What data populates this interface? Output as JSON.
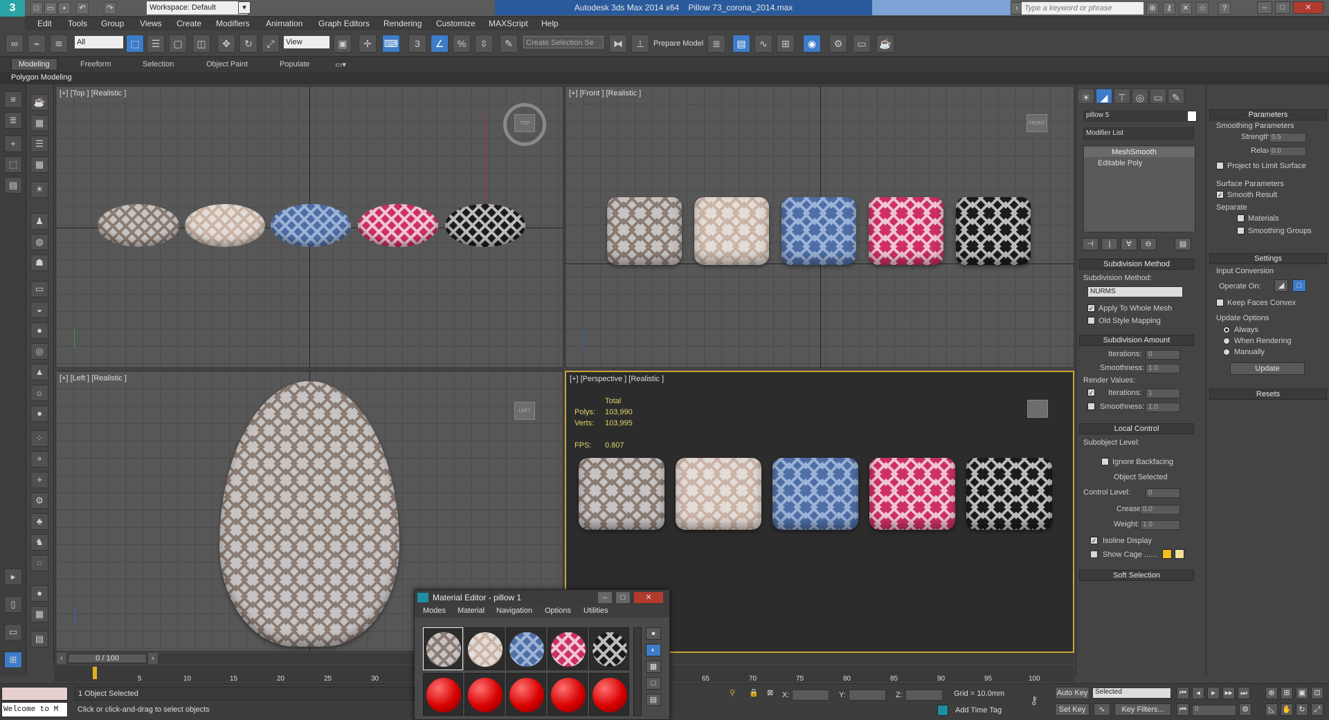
{
  "titlebar": {
    "workspace": "Workspace: Default",
    "app_title": "Autodesk 3ds Max  2014 x64",
    "file_title": "Pillow 73_corona_2014.max",
    "search_placeholder": "Type a keyword or phrase"
  },
  "menu": [
    "Edit",
    "Tools",
    "Group",
    "Views",
    "Create",
    "Modifiers",
    "Animation",
    "Graph Editors",
    "Rendering",
    "Customize",
    "MAXScript",
    "Help"
  ],
  "toolbar": {
    "selection_filter": "All",
    "ref_coord": "View",
    "selection_set": "Create Selection Se",
    "prepare_model": "Prepare Model"
  },
  "ribbon": {
    "tabs": [
      "Modeling",
      "Freeform",
      "Selection",
      "Object Paint",
      "Populate"
    ],
    "active_tab": "Modeling",
    "subpanel": "Polygon Modeling"
  },
  "viewports": {
    "top": "[+] [Top ] [Realistic ]",
    "front": "[+] [Front ] [Realistic ]",
    "left": "[+] [Left ] [Realistic ]",
    "perspective": "[+] [Perspective ] [Realistic ]",
    "stats": {
      "total_label": "Total",
      "polys_label": "Polys:",
      "polys": "103,990",
      "verts_label": "Verts:",
      "verts": "103,995",
      "fps_label": "FPS:",
      "fps": "0.807"
    },
    "viewcube": {
      "top": "TOP",
      "front": "FRONT",
      "left": "LEFT"
    }
  },
  "command_panel": {
    "object_name": "pillow 5",
    "modifier_list": "Modifier List",
    "stack": [
      "MeshSmooth",
      "Editable Poly"
    ],
    "subdivision_method": {
      "header": "Subdivision Method",
      "label": "Subdivision Method:",
      "value": "NURMS",
      "apply_whole_mesh": "Apply To Whole Mesh",
      "old_style_mapping": "Old Style Mapping"
    },
    "subdivision_amount": {
      "header": "Subdivision Amount",
      "iterations_label": "Iterations:",
      "iterations": "0",
      "smoothness_label": "Smoothness:",
      "smoothness": "1.0",
      "render_values": "Render Values:",
      "render_iterations_label": "Iterations:",
      "render_iterations": "1",
      "render_smoothness_label": "Smoothness:",
      "render_smoothness": "1.0"
    },
    "local_control": {
      "header": "Local Control",
      "subobject_level": "Subobject Level:",
      "ignore_backfacing": "Ignore Backfacing",
      "object_selected": "Object Selected",
      "control_level_label": "Control Level:",
      "control_level": "0",
      "crease_label": "Crease:",
      "crease": "0.0",
      "weight_label": "Weight:",
      "weight": "1.0",
      "isoline_display": "Isoline Display",
      "show_cage": "Show Cage ......"
    },
    "soft_selection": "Soft Selection"
  },
  "parameters_panel": {
    "header": "Parameters",
    "smoothing_params": "Smoothing Parameters",
    "strength_label": "Strength:",
    "strength": "0.5",
    "relax_label": "Relax:",
    "relax": "0.0",
    "project_limit": "Project to Limit Surface",
    "surface_params": "Surface Parameters",
    "smooth_result": "Smooth Result",
    "separate": "Separate",
    "materials": "Materials",
    "smoothing_groups": "Smoothing Groups",
    "settings_header": "Settings",
    "input_conversion": "Input Conversion",
    "operate_on": "Operate On:",
    "keep_faces_convex": "Keep Faces Convex",
    "update_options": "Update Options",
    "always": "Always",
    "when_rendering": "When Rendering",
    "manually": "Manually",
    "update_button": "Update",
    "resets": "Resets"
  },
  "timeline": {
    "frame": "0 / 100",
    "ticks": [
      "5",
      "10",
      "15",
      "20",
      "25",
      "30",
      "65",
      "70",
      "75",
      "80",
      "85",
      "90",
      "95",
      "100"
    ]
  },
  "status": {
    "maxscript": "Welcome to M",
    "selected": "1 Object Selected",
    "prompt": "Click or click-and-drag to select objects",
    "x_label": "X:",
    "y_label": "Y:",
    "z_label": "Z:",
    "grid": "Grid = 10.0mm",
    "add_time_tag": "Add Time Tag",
    "auto_key": "Auto Key",
    "set_key": "Set Key",
    "key_mode": "Selected",
    "key_filters": "Key Filters...",
    "frame_field": "0"
  },
  "material_editor": {
    "title": "Material Editor - pillow 1",
    "menu": [
      "Modes",
      "Material",
      "Navigation",
      "Options",
      "Utilities"
    ]
  },
  "colors": {
    "accent": "#3d7cc9",
    "title_highlight": "#2a5a9c",
    "perspective_border": "#c9a536",
    "stats_text": "#e0d66a"
  }
}
